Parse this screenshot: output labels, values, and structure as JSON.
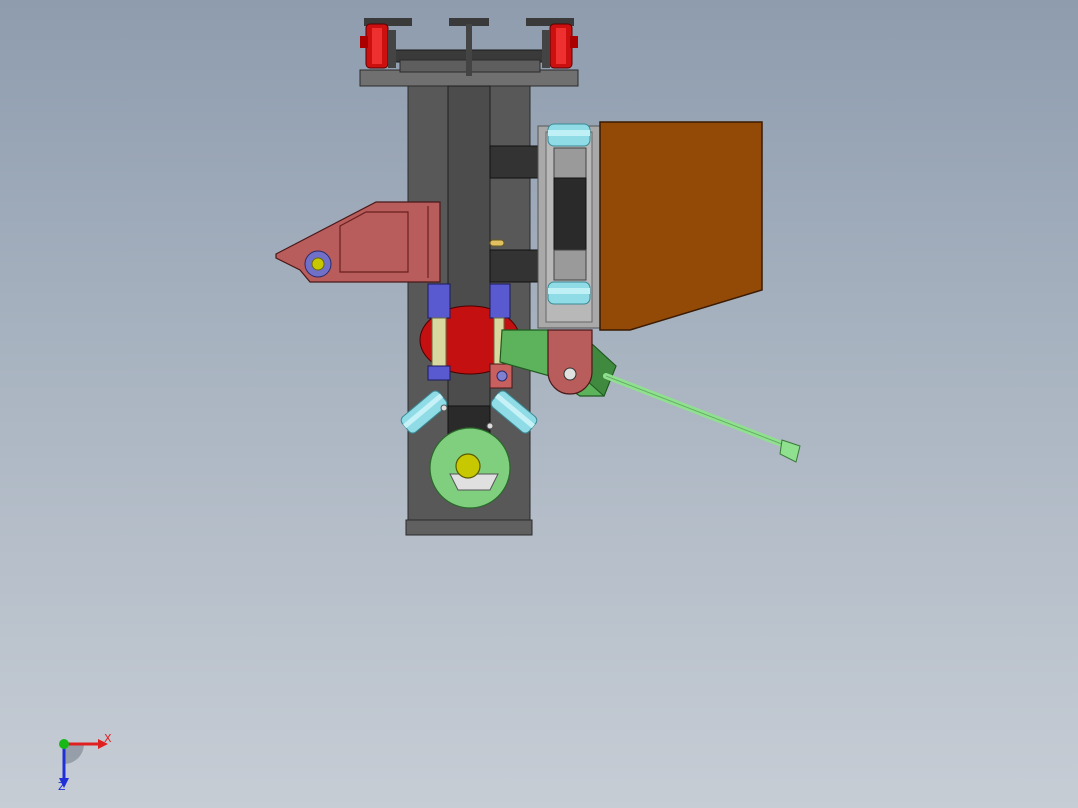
{
  "view": {
    "background_top": "#8e9cae",
    "background_bottom": "#c7cdd5"
  },
  "triad": {
    "x_label": "X",
    "z_label": "Z",
    "x_color": "#e02020",
    "y_color": "#18b818",
    "z_color": "#2030d8"
  },
  "colors": {
    "frame_dark": "#555555",
    "frame_mid": "#6a6a6a",
    "tube": "#4a4a4a",
    "caster_red": "#cc1010",
    "bracket_red": "#b85c5c",
    "motor_brown": "#924a06",
    "roller_cyan": "#8fdce6",
    "lever_green": "#5cb35c",
    "rod_green": "#8fe08f",
    "pulley_green": "#7fcf7f",
    "hub_yellow": "#c8c800",
    "block_blue": "#5a5ad0",
    "clamp_gray": "#a5a5a5"
  }
}
